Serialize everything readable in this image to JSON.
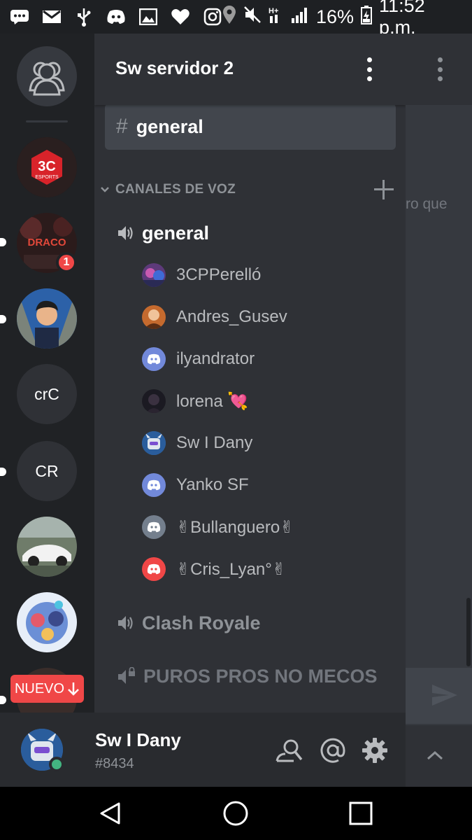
{
  "status_bar": {
    "battery": "16%",
    "time": "11:52 p.m.",
    "left_icons": [
      "message-icon",
      "gmail-icon",
      "usb-icon",
      "discord-icon",
      "gallery-icon",
      "heart-icon",
      "instagram-icon"
    ],
    "right_icons": [
      "location-icon",
      "mute-icon",
      "network-icon",
      "signal-icon",
      "battery-icon"
    ]
  },
  "rail": {
    "servers": [
      {
        "kind": "logo",
        "name": "3C Esports"
      },
      {
        "kind": "logo",
        "name": "Draco",
        "badge": "1"
      },
      {
        "kind": "image",
        "name": "avatar-server"
      },
      {
        "kind": "text",
        "name": "crC"
      },
      {
        "kind": "text",
        "name": "CR"
      },
      {
        "kind": "image",
        "name": "car-server"
      },
      {
        "kind": "image",
        "name": "game-server"
      }
    ],
    "new_label": "NUEVO"
  },
  "header": {
    "server_name": "Sw servidor 2"
  },
  "channels": {
    "selected_text": {
      "name": "general"
    },
    "voice_category": "CANALES DE VOZ",
    "voice_channels": [
      {
        "name": "general",
        "users": [
          {
            "name": "3CPPerelló",
            "avatar": "photo"
          },
          {
            "name": "Andres_Gusev",
            "avatar": "photo"
          },
          {
            "name": "ilyandrator",
            "avatar": "discord"
          },
          {
            "name": "lorena 💘",
            "avatar": "photo"
          },
          {
            "name": "Sw I Dany",
            "avatar": "robot"
          },
          {
            "name": "Yanko SF",
            "avatar": "discord"
          },
          {
            "name": "✌Bullanguero✌",
            "avatar": "discord-grey"
          },
          {
            "name": "✌Cris_Lyan°✌",
            "avatar": "discord-red"
          }
        ]
      },
      {
        "name": "Clash Royale"
      },
      {
        "name": "PUROS PROS NO MECOS",
        "locked": true
      }
    ]
  },
  "chat_behind": {
    "snippet": "ro que"
  },
  "user_bar": {
    "username": "Sw I Dany",
    "discriminator": "#8434"
  },
  "colors": {
    "rail": "#202225",
    "panel": "#2f3136",
    "selected": "#42464d",
    "blurple": "#7289da",
    "red": "#f04747",
    "online": "#43b581"
  }
}
